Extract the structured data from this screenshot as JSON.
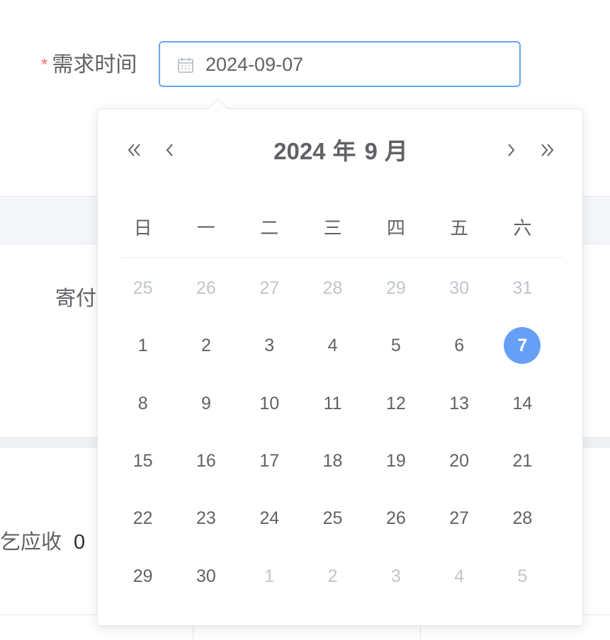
{
  "form": {
    "required_mark": "*",
    "date_label": "需求时间",
    "date_value": "2024-09-07",
    "mailing_label": "寄付",
    "receivable_label": "乞应收",
    "receivable_value": "0"
  },
  "picker": {
    "year": "2024",
    "year_unit": "年",
    "month": "9",
    "month_unit": "月",
    "nav": {
      "prev_year": "«",
      "prev_month": "‹",
      "next_month": "›",
      "next_year": "»"
    },
    "weekdays": [
      "日",
      "一",
      "二",
      "三",
      "四",
      "五",
      "六"
    ],
    "weeks": [
      [
        {
          "d": "25",
          "o": true
        },
        {
          "d": "26",
          "o": true
        },
        {
          "d": "27",
          "o": true
        },
        {
          "d": "28",
          "o": true
        },
        {
          "d": "29",
          "o": true
        },
        {
          "d": "30",
          "o": true
        },
        {
          "d": "31",
          "o": true
        }
      ],
      [
        {
          "d": "1"
        },
        {
          "d": "2"
        },
        {
          "d": "3"
        },
        {
          "d": "4"
        },
        {
          "d": "5"
        },
        {
          "d": "6"
        },
        {
          "d": "7",
          "s": true
        }
      ],
      [
        {
          "d": "8"
        },
        {
          "d": "9"
        },
        {
          "d": "10"
        },
        {
          "d": "11"
        },
        {
          "d": "12"
        },
        {
          "d": "13"
        },
        {
          "d": "14"
        }
      ],
      [
        {
          "d": "15"
        },
        {
          "d": "16"
        },
        {
          "d": "17"
        },
        {
          "d": "18"
        },
        {
          "d": "19"
        },
        {
          "d": "20"
        },
        {
          "d": "21"
        }
      ],
      [
        {
          "d": "22"
        },
        {
          "d": "23"
        },
        {
          "d": "24"
        },
        {
          "d": "25"
        },
        {
          "d": "26"
        },
        {
          "d": "27"
        },
        {
          "d": "28"
        }
      ],
      [
        {
          "d": "29"
        },
        {
          "d": "30"
        },
        {
          "d": "1",
          "o": true
        },
        {
          "d": "2",
          "o": true
        },
        {
          "d": "3",
          "o": true
        },
        {
          "d": "4",
          "o": true
        },
        {
          "d": "5",
          "o": true
        }
      ]
    ],
    "selected_date": "7"
  },
  "colors": {
    "accent": "#66a0f6",
    "input_border": "#66a6f0",
    "required": "#f56c6c",
    "text": "#606266",
    "muted": "#c0c4cc"
  },
  "icons": {
    "date_input": "calendar-icon"
  }
}
